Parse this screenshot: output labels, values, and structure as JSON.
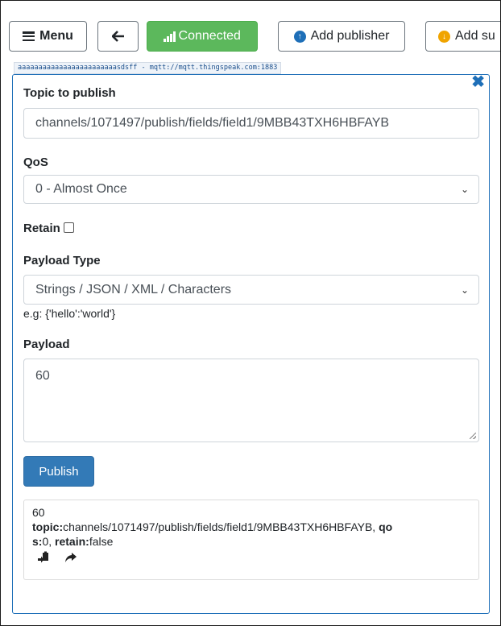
{
  "toolbar": {
    "menu_label": "Menu",
    "back_icon": "arrow-left-icon",
    "connected_label": "Connected",
    "add_publisher_label": "Add publisher",
    "add_subscriber_label": "Add su"
  },
  "connection": {
    "label": "aaaaaaaaaaaaaaaaaaaaaaaasdsff - mqtt://mqtt.thingspeak.com:1883"
  },
  "publisher": {
    "topic_label": "Topic to publish",
    "topic_value": "channels/1071497/publish/fields/field1/9MBB43TXH6HBFAYB",
    "qos_label": "QoS",
    "qos_value": "0 - Almost Once",
    "retain_label": "Retain",
    "retain_checked": false,
    "payload_type_label": "Payload Type",
    "payload_type_value": "Strings / JSON / XML / Characters",
    "payload_hint": "e.g: {'hello':'world'}",
    "payload_label": "Payload",
    "payload_value": "60",
    "publish_label": "Publish"
  },
  "message": {
    "payload": "60",
    "topic_key": "topic:",
    "topic_value": "channels/1071497/publish/fields/field1/9MBB43TXH6HBFAYB, ",
    "qos_key_a": "qo",
    "qos_key_b": "s:",
    "qos_value": "0, ",
    "retain_key": "retain:",
    "retain_value": "false"
  },
  "colors": {
    "connected": "#5cb85c",
    "primary": "#337ab7",
    "panel_border": "#1e6fb8"
  }
}
